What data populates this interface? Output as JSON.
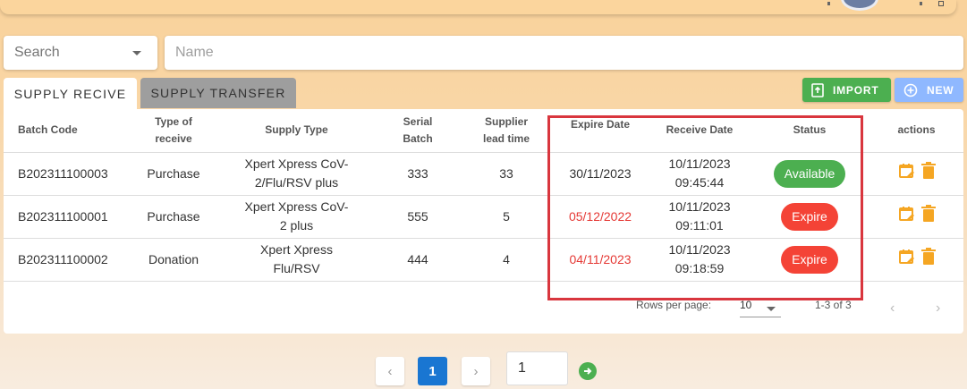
{
  "filters": {
    "search_label": "Search",
    "name_placeholder": "Name"
  },
  "tabs": [
    {
      "label": "SUPPLY RECIVE",
      "active": true
    },
    {
      "label": "SUPPLY TRANSFER",
      "active": false
    }
  ],
  "toolbar": {
    "import_label": "IMPORT",
    "new_label": "NEW"
  },
  "table": {
    "columns": [
      "Batch Code",
      "Type of receive",
      "Supply Type",
      "Serial Batch",
      "Supplier lead time",
      "Expire Date",
      "Receive Date",
      "Status",
      "actions"
    ],
    "rows": [
      {
        "batch_code": "B202311100003",
        "type": "Purchase",
        "supply_type": "Xpert Xpress CoV-2/Flu/RSV plus",
        "serial": "333",
        "lead_time": "33",
        "expire": "30/11/2023",
        "receive_date": "10/11/2023",
        "receive_time": "09:45:44",
        "status": "Available"
      },
      {
        "batch_code": "B202311100001",
        "type": "Purchase",
        "supply_type": "Xpert Xpress CoV-2 plus",
        "serial": "555",
        "lead_time": "5",
        "expire": "05/12/2022",
        "receive_date": "10/11/2023",
        "receive_time": "09:11:01",
        "status": "Expire"
      },
      {
        "batch_code": "B202311100002",
        "type": "Donation",
        "supply_type": "Xpert Xpress Flu/RSV",
        "serial": "444",
        "lead_time": "4",
        "expire": "04/11/2023",
        "receive_date": "10/11/2023",
        "receive_time": "09:18:59",
        "status": "Expire"
      }
    ]
  },
  "table_footer": {
    "rows_per_page_label": "Rows per page:",
    "rows_per_page_value": "10",
    "range_text": "1-3 of 3"
  },
  "pagination": {
    "current_page": "1",
    "goto_value": "1"
  },
  "colors": {
    "accent": "#1976d2",
    "available": "#4caf50",
    "expire": "#f44336",
    "action_icon": "#f5a623",
    "highlight_box": "#d9363e"
  }
}
